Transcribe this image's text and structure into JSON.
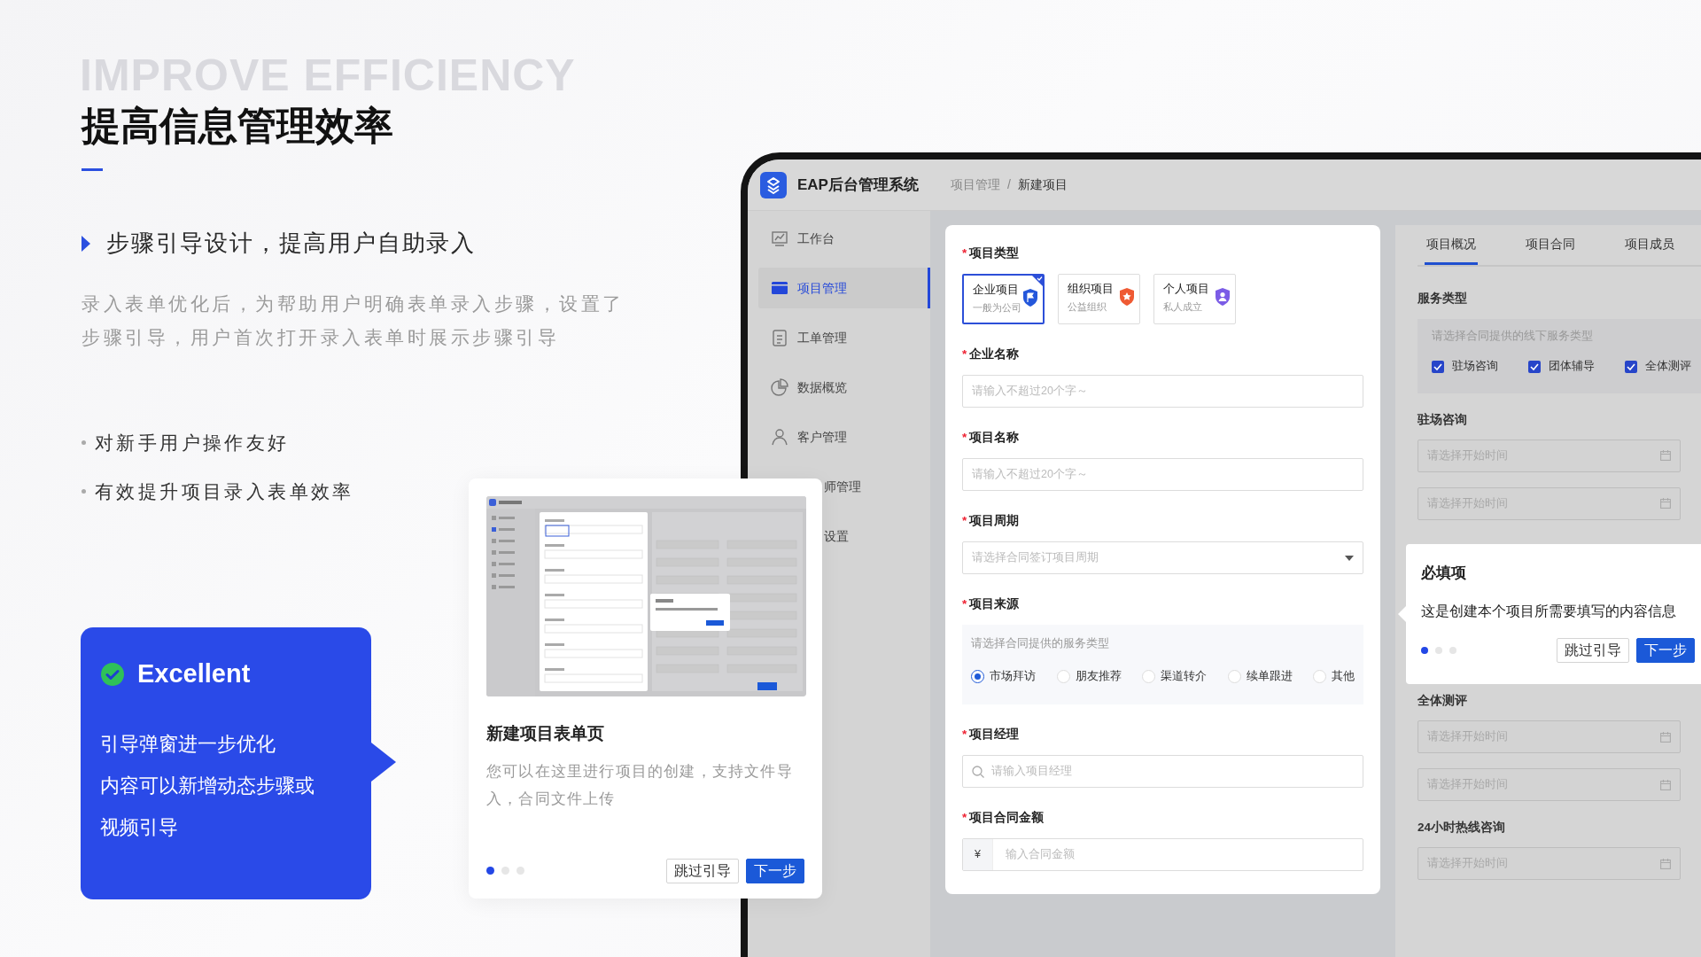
{
  "background_text": "IMPROVE EFFICIENCY",
  "heading": "提高信息管理效率",
  "subheading": "步骤引导设计，提高用户自助录入",
  "description": "录入表单优化后，为帮助用户明确表单录入步骤，设置了步骤引导，用户首次打开录入表单时展示步骤引导",
  "bullets": [
    "对新手用户操作友好",
    "有效提升项目录入表单效率"
  ],
  "highlight_card": {
    "title": "Excellent",
    "lines": [
      "引导弹窗进一步优化",
      "内容可以新增动态步骤或",
      "视频引导"
    ]
  },
  "guide_card": {
    "title": "新建项目表单页",
    "text": "您可以在这里进行项目的创建，支持文件导入，合同文件上传",
    "dots": [
      {
        "selected": true
      },
      {
        "selected": false
      },
      {
        "selected": false
      }
    ],
    "buttons": [
      {
        "kind": "secondary",
        "label": "跳过引导"
      },
      {
        "kind": "primary",
        "label": "下一步"
      }
    ]
  },
  "app": {
    "title": "EAP后台管理系统",
    "breadcrumb": [
      "项目管理",
      "新建项目"
    ],
    "breadcrumb_separator": "/",
    "required_mark": "*",
    "sidebar": [
      {
        "label": "工作台",
        "selected": false
      },
      {
        "label": "项目管理",
        "selected": true
      },
      {
        "label": "工单管理",
        "selected": false
      },
      {
        "label": "数据概览",
        "selected": false
      },
      {
        "label": "客户管理",
        "selected": false
      },
      {
        "label": "师管理",
        "selected": false
      },
      {
        "label": "设置",
        "selected": false
      }
    ],
    "form": [
      {
        "kind": "type_choice",
        "label": "项目类型",
        "required": true,
        "options": [
          {
            "title": "企业项目",
            "subtitle": "一般为公司",
            "selected": true
          },
          {
            "title": "组织项目",
            "subtitle": "公益组织",
            "selected": false
          },
          {
            "title": "个人项目",
            "subtitle": "私人成立",
            "selected": false
          }
        ]
      },
      {
        "kind": "text",
        "label": "企业名称",
        "required": true,
        "placeholder": "请输入不超过20个字～"
      },
      {
        "kind": "text",
        "label": "项目名称",
        "required": true,
        "placeholder": "请输入不超过20个字～"
      },
      {
        "kind": "select",
        "label": "项目周期",
        "required": true,
        "placeholder": "请选择合同签订项目周期"
      },
      {
        "kind": "radio",
        "label": "项目来源",
        "required": true,
        "hint": "请选择合同提供的服务类型",
        "options": [
          {
            "label": "市场拜访",
            "selected": true
          },
          {
            "label": "朋友推荐",
            "selected": false
          },
          {
            "label": "渠道转介",
            "selected": false
          },
          {
            "label": "续单跟进",
            "selected": false
          },
          {
            "label": "其他",
            "selected": false
          }
        ]
      },
      {
        "kind": "search",
        "label": "项目经理",
        "required": true,
        "placeholder": "请输入项目经理"
      },
      {
        "kind": "amount",
        "label": "项目合同金额",
        "required": true,
        "prefix": "¥",
        "placeholder": "输入合同金额"
      }
    ],
    "detail": {
      "tabs": [
        {
          "label": "项目概况",
          "selected": true
        },
        {
          "label": "项目合同",
          "selected": false
        },
        {
          "label": "项目成员",
          "selected": false
        }
      ],
      "service_type": {
        "label": "服务类型",
        "hint": "请选择合同提供的线下服务类型",
        "options": [
          {
            "label": "驻场咨询",
            "checked": true
          },
          {
            "label": "团体辅导",
            "checked": true
          },
          {
            "label": "全体测评",
            "checked": true
          }
        ]
      },
      "sections": [
        {
          "label": "驻场咨询",
          "dates": [
            "请选择开始时间",
            "请选择开始时间"
          ]
        },
        {
          "label": "全体测评",
          "dates": [
            "请选择开始时间",
            "请选择开始时间"
          ]
        },
        {
          "label": "24小时热线咨询",
          "dates": [
            "请选择开始时间"
          ]
        }
      ]
    },
    "popover": {
      "title": "必填项",
      "text": "这是创建本个项目所需要填写的内容信息",
      "dots": [
        {
          "selected": true
        },
        {
          "selected": false
        },
        {
          "selected": false
        }
      ],
      "buttons": [
        {
          "kind": "secondary",
          "label": "跳过引导"
        },
        {
          "kind": "primary",
          "label": "下一步"
        }
      ]
    }
  }
}
